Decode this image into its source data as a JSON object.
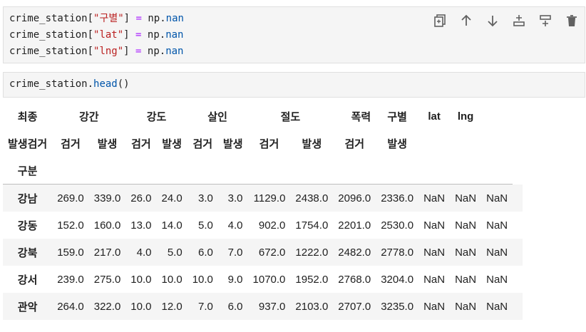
{
  "cell1": {
    "lines": [
      {
        "var": "crime_station",
        "open": "[",
        "key": "\"구별\"",
        "close": "]",
        "eq": " = ",
        "mod": "np",
        "dot": ".",
        "attr": "nan"
      },
      {
        "var": "crime_station",
        "open": "[",
        "key": "\"lat\"",
        "close": "]",
        "eq": " = ",
        "mod": "np",
        "dot": ".",
        "attr": "nan"
      },
      {
        "var": "crime_station",
        "open": "[",
        "key": "\"lng\"",
        "close": "]",
        "eq": " = ",
        "mod": "np",
        "dot": ".",
        "attr": "nan"
      }
    ]
  },
  "toolbar": {
    "icons": [
      "copy-icon",
      "arrow-up-icon",
      "arrow-down-icon",
      "insert-above-icon",
      "insert-below-icon",
      "trash-icon"
    ]
  },
  "cell2": {
    "var": "crime_station",
    "dot": ".",
    "method": "head",
    "parens": "()"
  },
  "table": {
    "header_row1": [
      "최종",
      "강간",
      "",
      "강도",
      "",
      "살인",
      "",
      "절도",
      "",
      "폭력",
      "구별",
      "lat",
      "lng"
    ],
    "header_row2": [
      "발생검거",
      "검거",
      "발생",
      "검거",
      "발생",
      "검거",
      "발생",
      "검거",
      "발생",
      "검거",
      "발생",
      "",
      "",
      ""
    ],
    "header_row3": [
      "구분"
    ],
    "rows": [
      {
        "label": "강남",
        "values": [
          "269.0",
          "339.0",
          "26.0",
          "24.0",
          "3.0",
          "3.0",
          "1129.0",
          "2438.0",
          "2096.0",
          "2336.0",
          "NaN",
          "NaN",
          "NaN"
        ]
      },
      {
        "label": "강동",
        "values": [
          "152.0",
          "160.0",
          "13.0",
          "14.0",
          "5.0",
          "4.0",
          "902.0",
          "1754.0",
          "2201.0",
          "2530.0",
          "NaN",
          "NaN",
          "NaN"
        ]
      },
      {
        "label": "강북",
        "values": [
          "159.0",
          "217.0",
          "4.0",
          "5.0",
          "6.0",
          "7.0",
          "672.0",
          "1222.0",
          "2482.0",
          "2778.0",
          "NaN",
          "NaN",
          "NaN"
        ]
      },
      {
        "label": "강서",
        "values": [
          "239.0",
          "275.0",
          "10.0",
          "10.0",
          "10.0",
          "9.0",
          "1070.0",
          "1952.0",
          "2768.0",
          "3204.0",
          "NaN",
          "NaN",
          "NaN"
        ]
      },
      {
        "label": "관악",
        "values": [
          "264.0",
          "322.0",
          "10.0",
          "12.0",
          "7.0",
          "6.0",
          "937.0",
          "2103.0",
          "2707.0",
          "3235.0",
          "NaN",
          "NaN",
          "NaN"
        ]
      }
    ]
  }
}
